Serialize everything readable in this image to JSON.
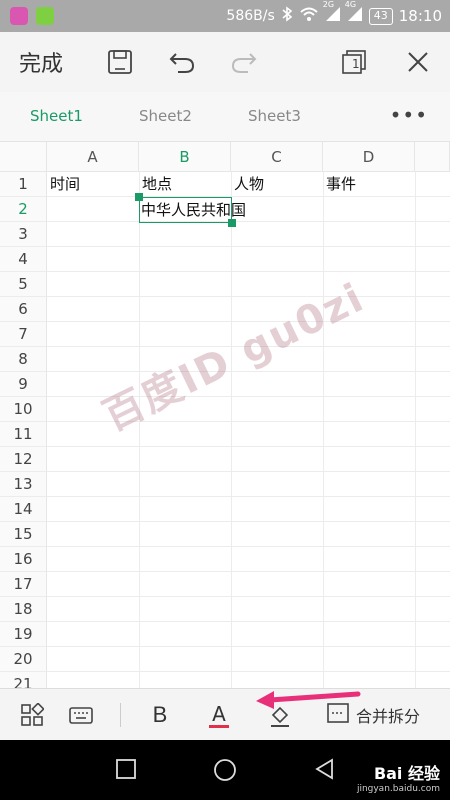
{
  "status_bar": {
    "speed": "586B/s",
    "net_2g": "2G",
    "net_4g": "4G",
    "battery": "43",
    "time": "18:10"
  },
  "toolbar": {
    "done_label": "完成",
    "page_count": "1"
  },
  "tabs": [
    {
      "label": "Sheet1",
      "active": true
    },
    {
      "label": "Sheet2",
      "active": false
    },
    {
      "label": "Sheet3",
      "active": false
    }
  ],
  "tabs_more": "•••",
  "grid": {
    "columns": [
      "A",
      "B",
      "C",
      "D"
    ],
    "rows": [
      "1",
      "2",
      "3",
      "4",
      "5",
      "6",
      "7",
      "8",
      "9",
      "10",
      "11",
      "12",
      "13",
      "14",
      "15",
      "16",
      "17",
      "18",
      "19",
      "20",
      "21"
    ],
    "cells": {
      "A1": "时间",
      "B1": "地点",
      "C1": "人物",
      "D1": "事件",
      "B2": "中华人民共和国"
    },
    "active_cell": "B2"
  },
  "watermark": "百度ID gu0zi",
  "bottom_toolbar": {
    "bold_label": "B",
    "font_color_label": "A",
    "merge_label": "合并拆分",
    "accent_color": "#e0304a"
  },
  "nav": {
    "brand": "Bai 经验",
    "brand_url_text": "jingyan.baidu.com"
  },
  "colors": {
    "accent": "#1a9a66",
    "arrow": "#e8307a"
  }
}
